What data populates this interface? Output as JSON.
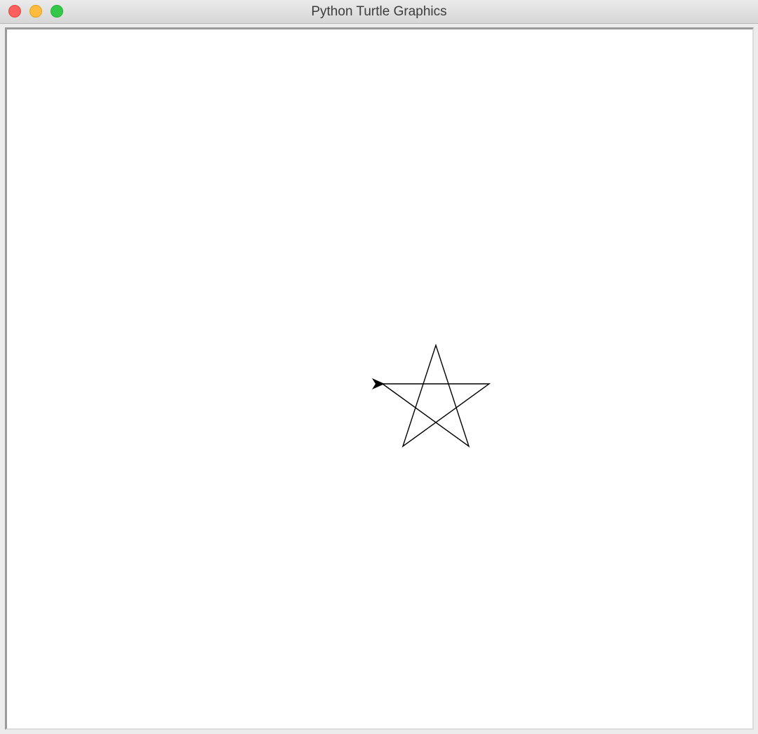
{
  "window": {
    "title": "Python Turtle Graphics",
    "controls": {
      "close_color": "#fc605c",
      "minimize_color": "#fdbc40",
      "zoom_color": "#34c84a"
    }
  },
  "canvas": {
    "background": "#ffffff",
    "pen_color": "#000000",
    "turtle_color": "#000000",
    "turtle_shape": "classic-arrow"
  }
}
